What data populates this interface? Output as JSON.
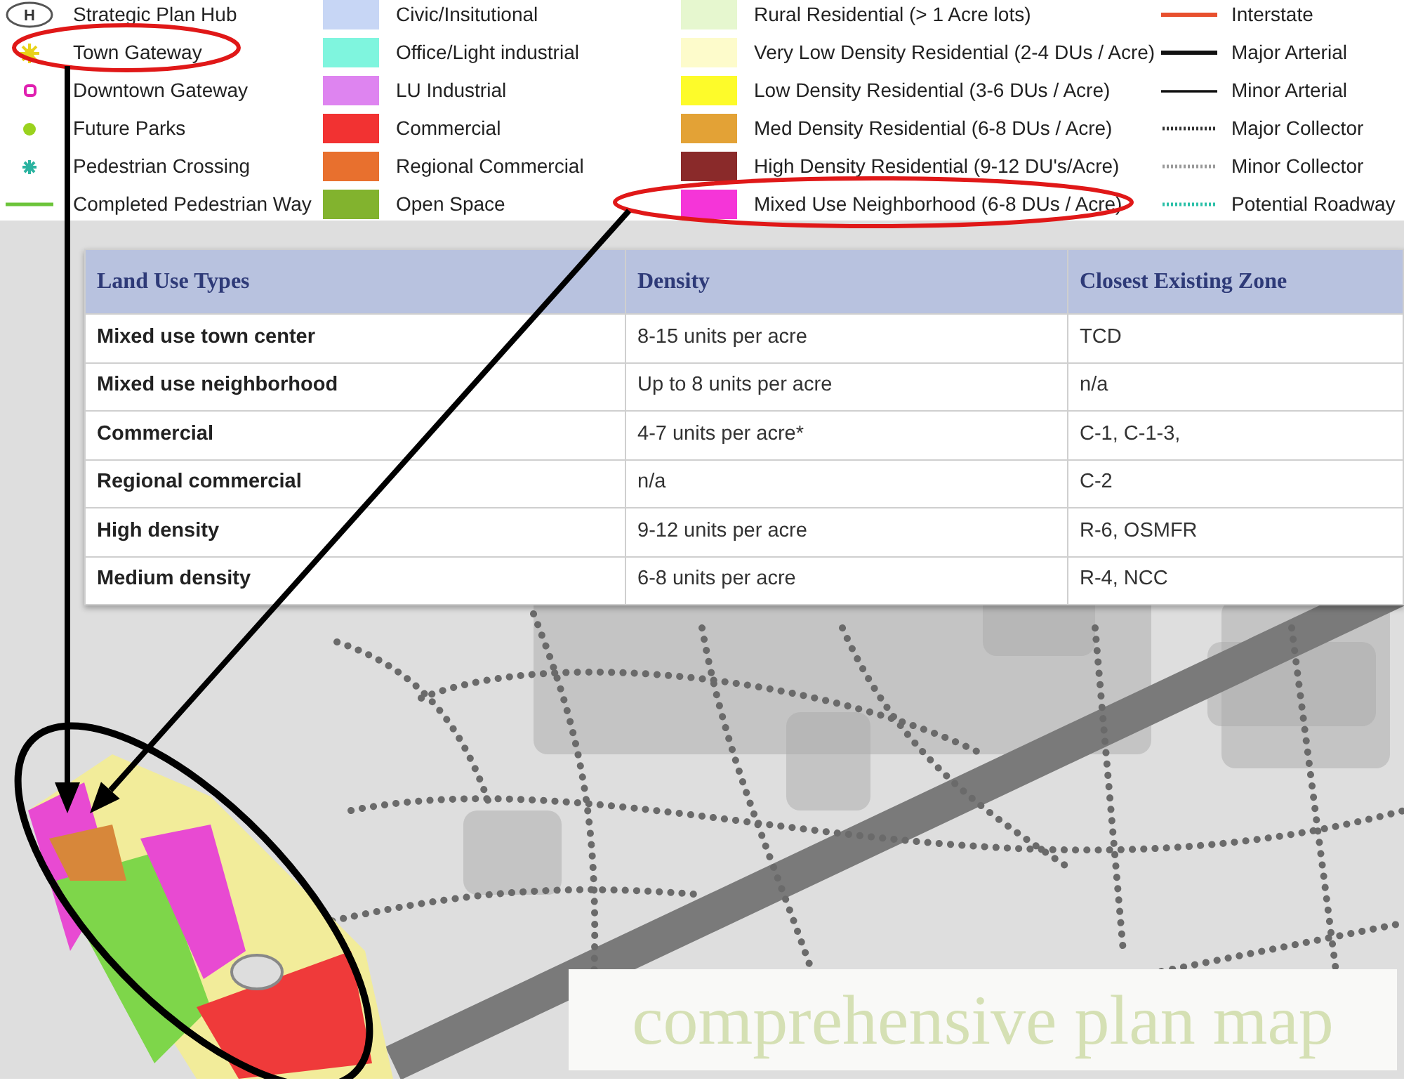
{
  "legend": {
    "columns": [
      [
        {
          "label": "Strategic Plan Hub",
          "kind": "hub",
          "symbol_text": "H",
          "color": "#555555",
          "highlighted": false
        },
        {
          "label": "Town Gateway",
          "kind": "sunburst",
          "color": "#e8d21a",
          "highlighted": true
        },
        {
          "label": "Downtown Gateway",
          "kind": "ring",
          "color": "#e020b0",
          "highlighted": false
        },
        {
          "label": "Future Parks",
          "kind": "dot",
          "color": "#9ad21e",
          "highlighted": false
        },
        {
          "label": "Pedestrian Crossing",
          "kind": "asterisk",
          "color": "#2bb3a0",
          "highlighted": false
        },
        {
          "label": "Completed Pedestrian Way",
          "kind": "line",
          "color": "#6cc43a",
          "highlighted": false
        }
      ],
      [
        {
          "label": "Civic/Insitutional",
          "kind": "swatch",
          "color": "#c7d6f5",
          "highlighted": false
        },
        {
          "label": "Office/Light industrial",
          "kind": "swatch",
          "color": "#7ff5de",
          "highlighted": false
        },
        {
          "label": "LU Industrial",
          "kind": "swatch",
          "color": "#de84f0",
          "highlighted": false
        },
        {
          "label": "Commercial",
          "kind": "swatch",
          "color": "#f23232",
          "highlighted": false
        },
        {
          "label": "Regional Commercial",
          "kind": "swatch",
          "color": "#e8702e",
          "highlighted": false
        },
        {
          "label": "Open Space",
          "kind": "swatch",
          "color": "#82b32e",
          "highlighted": false
        }
      ],
      [
        {
          "label": "Rural Residential (> 1 Acre lots)",
          "kind": "swatch",
          "color": "#e6f7cf",
          "highlighted": false
        },
        {
          "label": "Very Low Density Residential (2-4 DUs / Acre)",
          "kind": "swatch",
          "color": "#fdfbcb",
          "highlighted": false
        },
        {
          "label": "Low Density Residential  (3-6 DUs / Acre)",
          "kind": "swatch",
          "color": "#fdfb2a",
          "highlighted": false
        },
        {
          "label": "Med Density Residential (6-8 DUs / Acre)",
          "kind": "swatch",
          "color": "#e3a236",
          "highlighted": false
        },
        {
          "label": "High Density Residential (9-12 DU's/Acre)",
          "kind": "swatch",
          "color": "#8a2a2a",
          "highlighted": false
        },
        {
          "label": "Mixed Use Neighborhood (6-8 DUs / Acre)",
          "kind": "swatch",
          "color": "#f535d8",
          "highlighted": true
        }
      ],
      [
        {
          "label": "Interstate",
          "kind": "line",
          "color": "#e8502e",
          "highlighted": false
        },
        {
          "label": "Major Arterial",
          "kind": "line",
          "color": "#111111",
          "highlighted": false
        },
        {
          "label": "Minor Arterial",
          "kind": "thin-line",
          "color": "#111111",
          "highlighted": false
        },
        {
          "label": "Major Collector",
          "kind": "dotted-line",
          "color": "#333333",
          "highlighted": false
        },
        {
          "label": "Minor Collector",
          "kind": "dotted-line",
          "color": "#999999",
          "highlighted": false
        },
        {
          "label": "Potential Roadway",
          "kind": "dotted-line",
          "color": "#2bc0a8",
          "highlighted": false
        }
      ]
    ]
  },
  "table": {
    "columns": [
      "Land Use Types",
      "Density",
      "Closest Existing Zone"
    ],
    "rows": [
      [
        "Mixed use town center",
        "8-15 units per acre",
        "TCD"
      ],
      [
        "Mixed use neighborhood",
        "Up to 8 units per acre",
        "n/a"
      ],
      [
        "Commercial",
        "4-7 units per acre*",
        "C-1, C-1-3,"
      ],
      [
        "Regional commercial",
        "n/a",
        "C-2"
      ],
      [
        "High density",
        "9-12 units per acre",
        "R-6, OSMFR"
      ],
      [
        "Medium density",
        "6-8 units per acre",
        "R-4, NCC"
      ]
    ]
  },
  "caption": "comprehensive plan map"
}
